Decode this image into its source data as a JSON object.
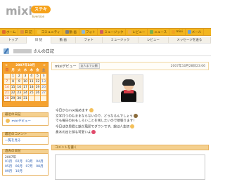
{
  "brand": {
    "logo": "mixi",
    "badge": "ステキ",
    "sub": "Eversion"
  },
  "nav": [
    {
      "label": "ホーム",
      "icon": "home-icon"
    },
    {
      "label": "日 記",
      "icon": "diary-icon"
    },
    {
      "label": "コミュニティ",
      "icon": "community-icon"
    },
    {
      "label": "動 画",
      "icon": "video-icon"
    },
    {
      "label": "フォト",
      "icon": "photo-icon"
    },
    {
      "label": "ミュージック",
      "icon": "music-icon"
    },
    {
      "label": "レビュー",
      "icon": "review-icon"
    },
    {
      "label": "ニュース",
      "icon": "news-icon"
    },
    {
      "label": "mixi",
      "icon": "mixi-icon"
    },
    {
      "label": "メール",
      "icon": "mail-icon"
    }
  ],
  "subnav": [
    "トップ",
    "日 記",
    "動 画",
    "フォト",
    "ミュージック",
    "レビュー",
    "メッセージを送る"
  ],
  "page": {
    "title_suffix": "さんの日記"
  },
  "calendar": {
    "month_label": "2007年10月",
    "prev_label": "<",
    "next_label": ">",
    "weekdays": [
      "日",
      "月",
      "火",
      "水",
      "木",
      "金",
      "土"
    ],
    "days": [
      "",
      "1",
      "2",
      "3",
      "4",
      "5",
      "6",
      "7",
      "8",
      "9",
      "10",
      "11",
      "12",
      "13",
      "14",
      "15",
      "16",
      "17",
      "18",
      "19",
      "20",
      "21",
      "22",
      "23",
      "24",
      "25",
      "26",
      "27",
      "28",
      "29",
      "30",
      "31",
      "",
      "",
      ""
    ]
  },
  "panels": {
    "recent_diary": {
      "title": "最近の日記",
      "item": "mixiデビュー"
    },
    "recent_comment": {
      "title": "最近のコメント",
      "item": "一覧を見る"
    },
    "past_diary": {
      "title": "過去の日記",
      "year": "2007年",
      "months": [
        "01月",
        "02月",
        "03月",
        "04月",
        "05月",
        "06月",
        "07月",
        "08月",
        "09月",
        "10月"
      ]
    }
  },
  "entry": {
    "title": "mixiデビュー",
    "badge": "友人まで公開",
    "date": "2007年10月28日23:06",
    "lines": [
      "今日からmixi始めます",
      "文字打つのもままならないので、どうなるんでしょう",
      "でも毎日のおもしろいことを残したいので頑張ります！",
      "今日は次男君と娘が風邪でダウンです。娘は人生初",
      "鼻水の出た顔も可愛いよ"
    ]
  },
  "comment": {
    "title": "コメントを書く"
  },
  "colors": {
    "nav_bg": "#f2b51f",
    "accent": "#f5a230"
  }
}
